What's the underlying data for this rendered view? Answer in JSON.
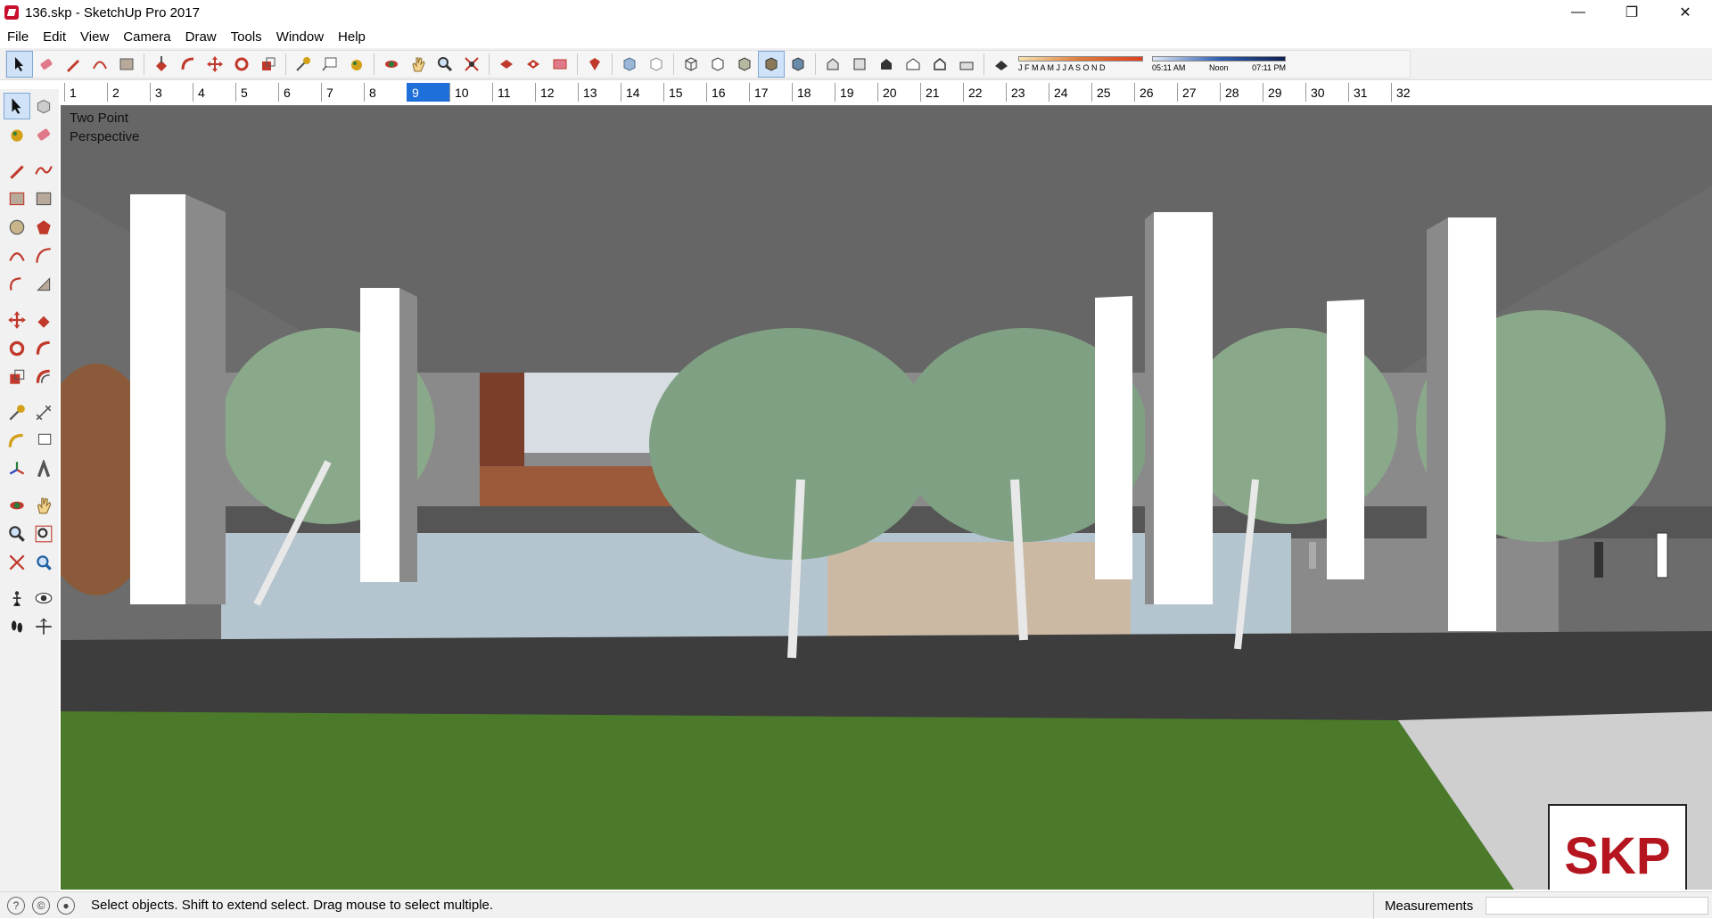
{
  "window": {
    "title": "136.skp - SketchUp Pro 2017",
    "controls": [
      "—",
      "❐",
      "✕"
    ]
  },
  "menu": [
    "File",
    "Edit",
    "View",
    "Camera",
    "Draw",
    "Tools",
    "Window",
    "Help"
  ],
  "toolbar": {
    "shadow_months": "J F M A M J J A S O N D",
    "time_start": "05:11 AM",
    "time_noon": "Noon",
    "time_end": "07:11 PM"
  },
  "scenes": {
    "tabs": [
      "1",
      "2",
      "3",
      "4",
      "5",
      "6",
      "7",
      "8",
      "9",
      "10",
      "11",
      "12",
      "13",
      "14",
      "15",
      "16",
      "17",
      "18",
      "19",
      "20",
      "21",
      "22",
      "23",
      "24",
      "25",
      "26",
      "27",
      "28",
      "29",
      "30",
      "31",
      "32"
    ],
    "active": "9"
  },
  "viewport": {
    "camera_label": "Two Point\nPerspective",
    "watermark": "SKP"
  },
  "status": {
    "hint": "Select objects. Shift to extend select. Drag mouse to select multiple.",
    "measurements_label": "Measurements",
    "measurements_value": ""
  },
  "colors": {
    "active_tab": "#1e6fd9",
    "ceiling": "#6c6c6c",
    "lawn": "#4a7a2a",
    "paving": "#3d3d3d",
    "column": "#ffffff",
    "tree_foliage": "#7fa082",
    "watermark_red": "#b4151f"
  }
}
